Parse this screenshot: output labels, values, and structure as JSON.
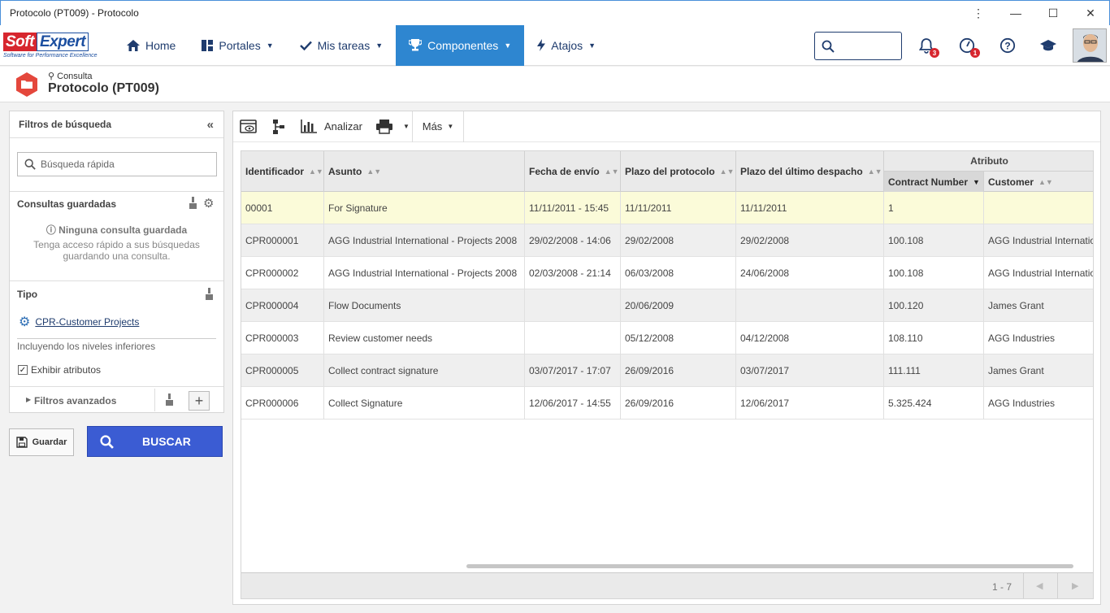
{
  "window": {
    "title": "Protocolo (PT009) - Protocolo"
  },
  "brand": {
    "soft": "Soft",
    "expert": "Expert",
    "tagline": "Software for Performance Excellence"
  },
  "nav": {
    "items": [
      {
        "label": "Home",
        "icon": "home-icon"
      },
      {
        "label": "Portales",
        "icon": "grid-icon"
      },
      {
        "label": "Mis tareas",
        "icon": "check-icon"
      },
      {
        "label": "Componentes",
        "icon": "trophy-icon",
        "active": true
      },
      {
        "label": "Atajos",
        "icon": "bolt-icon"
      }
    ],
    "notifications": {
      "bell_count": "3",
      "alerts_count": "1"
    }
  },
  "header": {
    "breadcrumb": "Consulta",
    "title": "Protocolo (PT009)"
  },
  "filters": {
    "title": "Filtros de búsqueda",
    "quick_search_placeholder": "Búsqueda rápida",
    "saved": {
      "title": "Consultas guardadas",
      "empty_title": "Ninguna consulta guardada",
      "empty_desc1": "Tenga acceso rápido a sus búsquedas",
      "empty_desc2": "guardando una consulta."
    },
    "type": {
      "title": "Tipo",
      "value": "CPR-Customer Projects",
      "note": "Incluyendo los niveles inferiores",
      "show_attrs_label": "Exhibir atributos",
      "show_attrs_checked": true
    },
    "advanced": {
      "title": "Filtros avanzados"
    }
  },
  "actions": {
    "save": "Guardar",
    "search": "BUSCAR"
  },
  "toolbar": {
    "analyze": "Analizar",
    "more": "Más"
  },
  "grid": {
    "group_header": "Atributo",
    "columns": [
      "Identificador",
      "Asunto",
      "Fecha de envío",
      "Plazo del protocolo",
      "Plazo del último despacho",
      "Contract Number",
      "Customer"
    ],
    "rows": [
      [
        "00001",
        "For Signature",
        "11/11/2011 - 15:45",
        "11/11/2011",
        "11/11/2011",
        "1",
        ""
      ],
      [
        "CPR000001",
        "AGG Industrial International - Projects 2008",
        "29/02/2008 - 14:06",
        "29/02/2008",
        "29/02/2008",
        "100.108",
        "AGG Industrial Internatio"
      ],
      [
        "CPR000002",
        "AGG Industrial International - Projects 2008",
        "02/03/2008 - 21:14",
        "06/03/2008",
        "24/06/2008",
        "100.108",
        "AGG Industrial Internatio"
      ],
      [
        "CPR000004",
        "Flow Documents",
        "",
        "20/06/2009",
        "",
        "100.120",
        "James Grant"
      ],
      [
        "CPR000003",
        "Review customer needs",
        "",
        "05/12/2008",
        "04/12/2008",
        "108.110",
        "AGG Industries"
      ],
      [
        "CPR000005",
        "Collect contract signature",
        "03/07/2017 - 17:07",
        "26/09/2016",
        "03/07/2017",
        "111.111",
        "James Grant"
      ],
      [
        "CPR000006",
        "Collect Signature",
        "12/06/2017 - 14:55",
        "26/09/2016",
        "12/06/2017",
        "5.325.424",
        "AGG Industries"
      ]
    ],
    "pagination": "1 - 7",
    "colors": {
      "selected_row": "#fbfbd9",
      "alt_row": "#efefef"
    }
  }
}
